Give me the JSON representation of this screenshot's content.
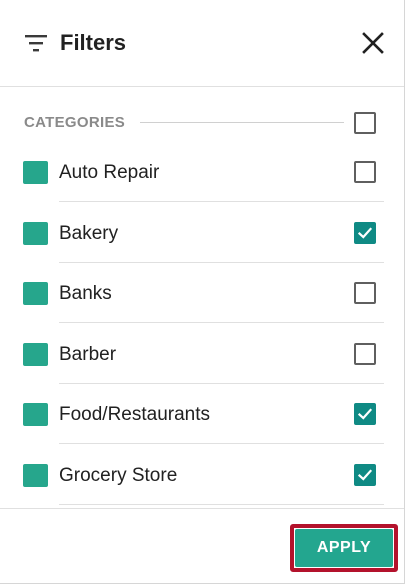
{
  "header": {
    "title": "Filters",
    "filter_icon": "filter-list-icon",
    "close_icon": "close-icon"
  },
  "categories": {
    "label": "CATEGORIES",
    "all_checked": false,
    "items": [
      {
        "label": "Auto Repair",
        "color": "#26a68c",
        "checked": false
      },
      {
        "label": "Bakery",
        "color": "#26a68c",
        "checked": true
      },
      {
        "label": "Banks",
        "color": "#26a68c",
        "checked": false
      },
      {
        "label": "Barber",
        "color": "#26a68c",
        "checked": false
      },
      {
        "label": "Food/Restaurants",
        "color": "#26a68c",
        "checked": true
      },
      {
        "label": "Grocery Store",
        "color": "#26a68c",
        "checked": true
      }
    ]
  },
  "footer": {
    "apply_label": "APPLY"
  },
  "colors": {
    "accent": "#23a68f",
    "checkbox_checked": "#0f8a84",
    "highlight": "#b3122c"
  }
}
